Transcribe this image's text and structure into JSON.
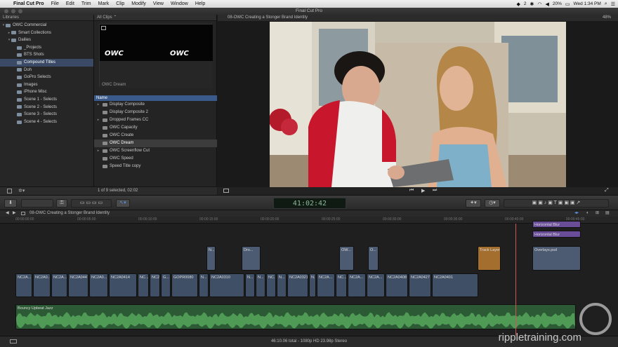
{
  "menubar": {
    "app_name": "Final Cut Pro",
    "items": [
      "File",
      "Edit",
      "Trim",
      "Mark",
      "Clip",
      "Modify",
      "View",
      "Window",
      "Help"
    ],
    "status": {
      "battery": "20%",
      "time": "Wed 1:34 PM",
      "badge_count": "2"
    }
  },
  "window": {
    "title": "Final Cut Pro"
  },
  "libraries": {
    "header": "Libraries",
    "items": [
      {
        "label": "OWC Commercial",
        "level": 0,
        "arrow": "▾"
      },
      {
        "label": "Smart Collections",
        "level": 1,
        "arrow": "▸"
      },
      {
        "label": "Dailies",
        "level": 1,
        "arrow": "▾"
      },
      {
        "label": "_Projects",
        "level": 2,
        "arrow": ""
      },
      {
        "label": "BTS Shots",
        "level": 2,
        "arrow": ""
      },
      {
        "label": "Compound Titles",
        "level": 2,
        "arrow": "",
        "selected": true
      },
      {
        "label": "Doh",
        "level": 2,
        "arrow": ""
      },
      {
        "label": "GoPro Selects",
        "level": 2,
        "arrow": ""
      },
      {
        "label": "Images",
        "level": 2,
        "arrow": ""
      },
      {
        "label": "iPhone Misc",
        "level": 2,
        "arrow": ""
      },
      {
        "label": "Scene 1 - Selects",
        "level": 2,
        "arrow": ""
      },
      {
        "label": "Scene 2 - Selects",
        "level": 2,
        "arrow": ""
      },
      {
        "label": "Scene 3 - Selects",
        "level": 2,
        "arrow": ""
      },
      {
        "label": "Scene 4 - Selects",
        "level": 2,
        "arrow": ""
      }
    ]
  },
  "browser": {
    "filter": "All Clips",
    "thumb_caption": "OWC Dream",
    "thumb_logo": "OWC",
    "column_header": "Name",
    "clips": [
      {
        "label": "Display Composite",
        "arrow": "▸"
      },
      {
        "label": "Display Composite 2",
        "arrow": ""
      },
      {
        "label": "Dropped Frames CC",
        "arrow": "▸"
      },
      {
        "label": "OWC Capacity",
        "arrow": ""
      },
      {
        "label": "OWC Create",
        "arrow": ""
      },
      {
        "label": "OWC Dream",
        "arrow": "",
        "selected": true
      },
      {
        "label": "OWC Screenflow Cut",
        "arrow": "▸"
      },
      {
        "label": "OWC Speed",
        "arrow": ""
      },
      {
        "label": "Speed Title copy",
        "arrow": ""
      }
    ],
    "selection_status": "1 of 9 selected, 02:02"
  },
  "viewer": {
    "title": "08-OWC Creating a Stonger Brand Identity",
    "zoom": "48%"
  },
  "toolbar": {
    "timecode": "41:02:42"
  },
  "timeline": {
    "project_name": "08-OWC Creating a Stonger Brand Identity",
    "ruler": [
      "00:00:00:00",
      "00:00:05:00",
      "00:00:10:00",
      "00:00:15:00",
      "00:00:20:00",
      "00:00:25:00",
      "00:00:30:00",
      "00:00:35:00",
      "00:00:40:00",
      "00:00:45:00"
    ],
    "connected": [
      {
        "label": "N..."
      },
      {
        "label": "Dro..."
      },
      {
        "label": "OW..."
      },
      {
        "label": "O..."
      },
      {
        "label": "Track Layer"
      },
      {
        "label": "Horizontal Blur"
      },
      {
        "label": "Horizontal Blur"
      },
      {
        "label": "Overlays.psd"
      }
    ],
    "primary": [
      "NC2A...",
      "NC2A0...",
      "NC2A...",
      "NC2A0447",
      "NC2A0...",
      "NC2A0414",
      "NC...",
      "NC2...",
      "G...",
      "GOPR0080",
      "N...",
      "NC2A0310",
      "N...",
      "N...",
      "NC...",
      "N...",
      "NC2A0321",
      "N...",
      "NC2A...",
      "NC...",
      "NC2A...",
      "NC2A...",
      "NC2A0408",
      "NC2A0427",
      "NC2A0401"
    ],
    "audio_label": "Bouncy Upbeat Jazz",
    "summary": "46:10.06 total - 1080p HD 23.98p Stereo"
  },
  "watermark": "rippletraining.com"
}
